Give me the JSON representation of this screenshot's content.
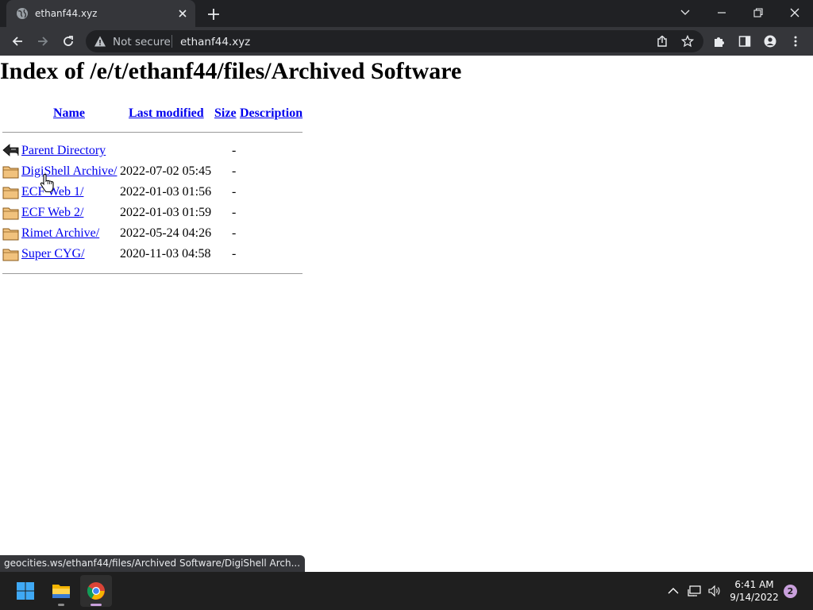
{
  "browser": {
    "tab": {
      "title": "ethanf44.xyz"
    },
    "omnibox": {
      "security_label": "Not secure",
      "url": "ethanf44.xyz"
    },
    "status_url": "geocities.ws/ethanf44/files/Archived Software/DigiShell Arch..."
  },
  "page": {
    "title": "Index of /e/t/ethanf44/files/Archived Software",
    "columns": {
      "name": "Name",
      "last_modified": "Last modified",
      "size": "Size",
      "description": "Description"
    },
    "rows": [
      {
        "icon": "back-arrow-icon",
        "name": "Parent Directory",
        "modified": "",
        "size": "-"
      },
      {
        "icon": "folder-icon",
        "name": "DigiShell Archive/",
        "modified": "2022-07-02 05:45",
        "size": "-"
      },
      {
        "icon": "folder-icon",
        "name": "ECF Web 1/",
        "modified": "2022-01-03 01:56",
        "size": "-"
      },
      {
        "icon": "folder-icon",
        "name": "ECF Web 2/",
        "modified": "2022-01-03 01:59",
        "size": "-"
      },
      {
        "icon": "folder-icon",
        "name": "Rimet Archive/",
        "modified": "2022-05-24 04:26",
        "size": "-"
      },
      {
        "icon": "folder-icon",
        "name": "Super CYG/",
        "modified": "2020-11-03 04:58",
        "size": "-"
      }
    ]
  },
  "taskbar": {
    "time": "6:41 AM",
    "date": "9/14/2022",
    "notification_count": "2"
  },
  "colors": {
    "link": "#0000ee",
    "chrome_dark": "#202124",
    "chrome_toolbar": "#35363a",
    "taskbar": "#1f1f1f",
    "accent": "#c9a0dc"
  }
}
